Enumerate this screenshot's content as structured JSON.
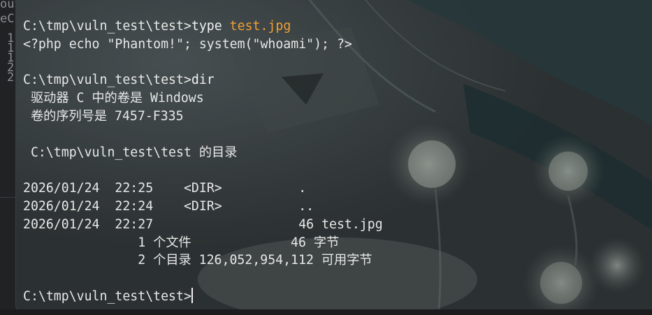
{
  "background_editor": {
    "fragments": [
      "out",
      "eC",
      "1",
      "1",
      "1",
      "2",
      "2"
    ]
  },
  "terminal": {
    "prompt": "C:\\tmp\\vuln_test\\test>",
    "cmd1": "type",
    "cmd1_arg": "test.jpg",
    "file_content": "<?php echo \"Phantom!\"; system(\"whoami\"); ?>",
    "cmd2": "dir",
    "volume_line": " 驱动器 C 中的卷是 Windows",
    "serial_line": " 卷的序列号是 7457-F335",
    "dir_of_line": " C:\\tmp\\vuln_test\\test 的目录",
    "entries": [
      {
        "date": "2026/01/24",
        "time": "22:25",
        "type": "<DIR>",
        "size": "",
        "name": "."
      },
      {
        "date": "2026/01/24",
        "time": "22:24",
        "type": "<DIR>",
        "size": "",
        "name": ".."
      },
      {
        "date": "2026/01/24",
        "time": "22:27",
        "type": "",
        "size": "46",
        "name": "test.jpg"
      }
    ],
    "summary_files": "               1 个文件             46 字节",
    "summary_dirs": "               2 个目录 126,052,954,112 可用字节"
  },
  "colors": {
    "text": "#e8e8e8",
    "highlight_file": "#f0a030",
    "terminal_bg": "#3f4547"
  }
}
